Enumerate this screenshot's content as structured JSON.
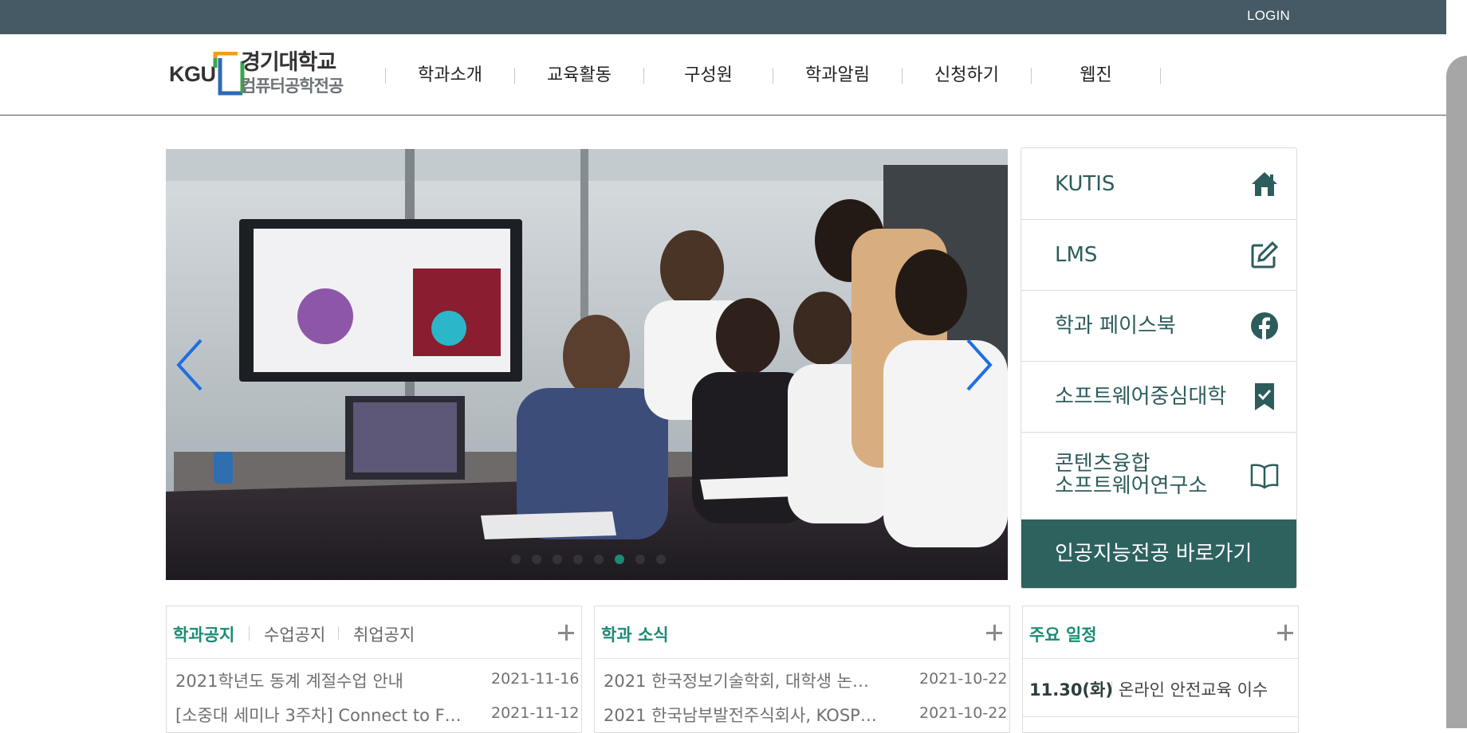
{
  "topbar": {
    "login": "LOGIN"
  },
  "logo": {
    "kgu": "KGU",
    "name": "경기대학교",
    "sub": "컴퓨터공학전공"
  },
  "nav": [
    "학과소개",
    "교육활동",
    "구성원",
    "학과알림",
    "신청하기",
    "웹진"
  ],
  "slider": {
    "slide_count": 8,
    "active_index": 5
  },
  "quick_links": {
    "items": [
      {
        "label": "KUTIS",
        "icon": "home-icon"
      },
      {
        "label": "LMS",
        "icon": "edit-icon"
      },
      {
        "label": "학과 페이스북",
        "icon": "facebook-icon"
      },
      {
        "label": "소프트웨어중심대학",
        "icon": "bookmark-check-icon"
      },
      {
        "label_line1": "콘텐츠융합",
        "label_line2": "소프트웨어연구소",
        "icon": "book-open-icon"
      }
    ],
    "ai_button": "인공지능전공 바로가기"
  },
  "boards": {
    "notices": {
      "tabs": [
        "학과공지",
        "수업공지",
        "취업공지"
      ],
      "rows": [
        {
          "title": "2021학년도 동계 계절수업 안내",
          "date": "2021-11-16"
        },
        {
          "title": "[소중대 세미나 3주차] Connect to F…",
          "date": "2021-11-12"
        }
      ]
    },
    "news": {
      "title": "학과 소식",
      "rows": [
        {
          "title": "2021 한국정보기술학회, 대학생 논…",
          "date": "2021-10-22"
        },
        {
          "title": "2021 한국남부발전주식회사, KOSP…",
          "date": "2021-10-22"
        }
      ]
    },
    "schedule": {
      "title": "주요 일정",
      "rows": [
        {
          "date": "11.30(화)",
          "title": "온라인 안전교육 이수"
        }
      ]
    }
  },
  "colors": {
    "accent": "#1b8b73",
    "topbar": "#455a65",
    "ai_button": "#2d625f",
    "quick_text": "#2d5c5c"
  }
}
